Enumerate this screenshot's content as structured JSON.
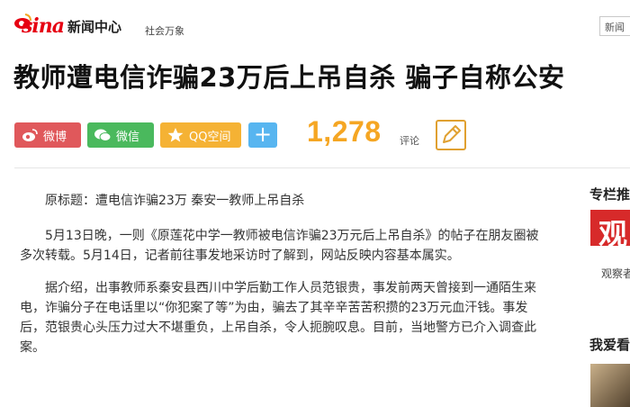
{
  "header": {
    "logo_text": "sina",
    "brand_sub": "新闻中心",
    "channel": "社会万象",
    "search_text": "新闻"
  },
  "headline": "教师遭电信诈骗23万后上吊自杀 骗子自称公安",
  "share": {
    "weibo": "微博",
    "wechat": "微信",
    "qq": "QQ空间",
    "plus": "+"
  },
  "comments": {
    "count": "1,278",
    "label": "评论"
  },
  "article": {
    "original_title": "原标题：遭电信诈骗23万 秦安一教师上吊自杀",
    "p1": "5月13日晚，一则《原莲花中学一教师被电信诈骗23万元后上吊自杀》的帖子在朋友圈被多次转载。5月14日，记者前往事发地采访时了解到，网站反映内容基本属实。",
    "p2": "据介绍，出事教师系秦安县西川中学后勤工作人员范银贵，事发前两天曾接到一通陌生来电，诈骗分子在电话里以“你犯案了等”为由，骗去了其辛辛苦苦积攒的23万元血汗钱。事发后，范银贵心头压力过大不堪重负，上吊自杀，令人扼腕叹息。目前，当地警方已介入调查此案。"
  },
  "sidebar": {
    "column_title": "专栏推荐",
    "column_logo_char": "观",
    "column_caption": "观察者",
    "favorites_title": "我爱看"
  },
  "colors": {
    "brand_red": "#e60012",
    "weibo": "#e0585b",
    "wechat": "#4ab95d",
    "qq": "#f5b234",
    "plus": "#57b5f0",
    "count": "#f5a623"
  }
}
